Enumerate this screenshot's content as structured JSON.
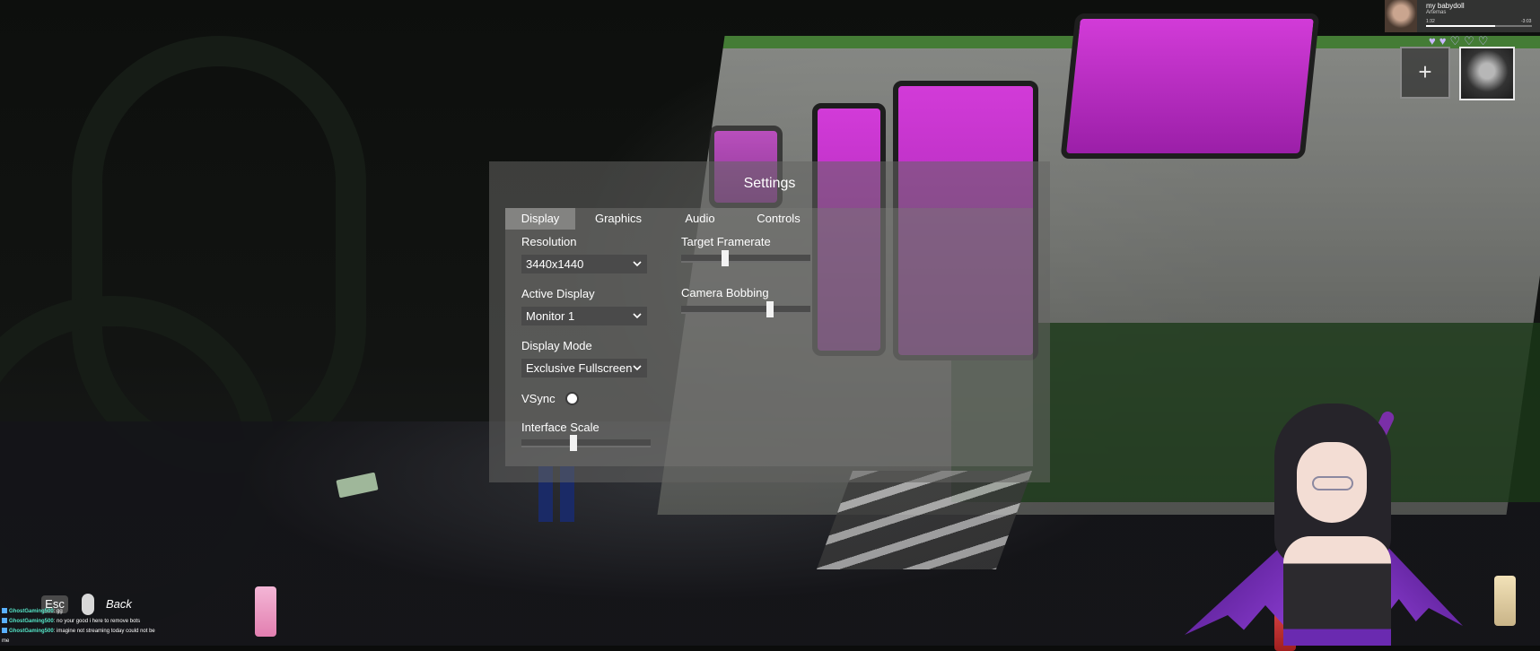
{
  "settings": {
    "title": "Settings",
    "tabs": [
      {
        "label": "Display",
        "active": true
      },
      {
        "label": "Graphics",
        "active": false
      },
      {
        "label": "Audio",
        "active": false
      },
      {
        "label": "Controls",
        "active": false
      }
    ],
    "display": {
      "resolution_label": "Resolution",
      "resolution_value": "3440x1440",
      "active_display_label": "Active Display",
      "active_display_value": "Monitor 1",
      "display_mode_label": "Display Mode",
      "display_mode_value": "Exclusive Fullscreen",
      "vsync_label": "VSync",
      "vsync_on": true,
      "interface_scale_label": "Interface Scale",
      "interface_scale_value": 0.4,
      "target_framerate_label": "Target Framerate",
      "target_framerate_value": 0.33,
      "camera_bobbing_label": "Camera Bobbing",
      "camera_bobbing_value": 0.7
    }
  },
  "hud": {
    "profile": {
      "name": "my babydoll",
      "subtitle": "Artemas",
      "elapsed": "1:32",
      "remaining": "-3:03",
      "progress": 0.65
    },
    "hearts": "♥♥♡♡♡",
    "plus_symbol": "+"
  },
  "controls_hint": {
    "esc_key": "Esc",
    "back_label": "Back"
  },
  "chat": [
    {
      "user": "GhostGaming500",
      "message": ": gg"
    },
    {
      "user": "GhostGaming500",
      "message": ": no your good i here to remove bots"
    },
    {
      "user": "GhostGaming500",
      "message": ": imagine not streaming today could not be me"
    }
  ],
  "colors": {
    "window_glow": "#c735d0",
    "rv_trim": "#4e8f3c",
    "wing": "#7a34c0"
  }
}
